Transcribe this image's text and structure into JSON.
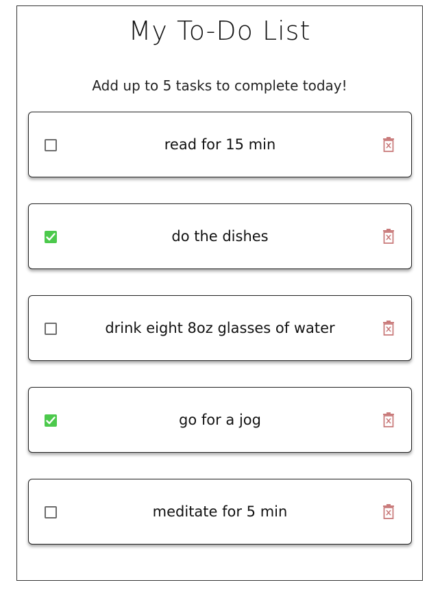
{
  "header": {
    "title": "My To-Do List",
    "subtitle": "Add up to 5 tasks to complete today!"
  },
  "colors": {
    "checked": "#4cc94c",
    "delete_icon": "#c97a7a",
    "border": "#222222"
  },
  "tasks": [
    {
      "text": "read for 15 min",
      "done": false,
      "icon": "trash-icon"
    },
    {
      "text": "do the dishes",
      "done": true,
      "icon": "trash-icon"
    },
    {
      "text": "drink eight 8oz glasses of water",
      "done": false,
      "icon": "trash-icon"
    },
    {
      "text": "go for a jog",
      "done": true,
      "icon": "trash-icon"
    },
    {
      "text": "meditate for 5 min",
      "done": false,
      "icon": "trash-icon"
    }
  ]
}
